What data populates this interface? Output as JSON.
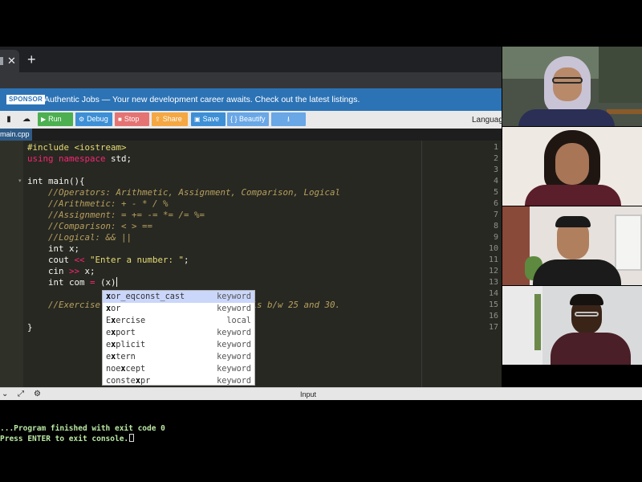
{
  "browser": {
    "tab_close": "✕",
    "new_tab": "+"
  },
  "banner": {
    "badge": "SPONSOR",
    "text": "Authentic Jobs — Your new development career awaits. Check out the latest listings."
  },
  "toolbar": {
    "run": "Run",
    "debug": "Debug",
    "stop": "Stop",
    "share": "Share",
    "save": "Save",
    "beautify": "{ } Beautify",
    "download": "⭳",
    "language": "Languag"
  },
  "file_tab": "main.cpp",
  "editor": {
    "line_numbers": [
      "1",
      "2",
      "3",
      "4",
      "5",
      "6",
      "7",
      "8",
      "9",
      "10",
      "11",
      "12",
      "13",
      "14",
      "15",
      "16",
      "17"
    ],
    "lines": {
      "l1_a": "#include",
      "l1_b": " <iostream>",
      "l2_a": "using",
      "l2_b": " namespace",
      "l2_c": " std;",
      "l4_a": "int",
      "l4_b": " main(){",
      "l5": "    //Operators: Arithmetic, Assignment, Comparison, Logical",
      "l6": "    //Arithmetic: + - * / %",
      "l7": "    //Assignment: = += -= *= /= %=",
      "l8": "    //Comparison: < > ==",
      "l9": "    //Logical: && ||",
      "l10_a": "    int",
      "l10_b": " x;",
      "l11_a": "    cout ",
      "l11_b": "<<",
      "l11_c": " \"Enter a number: \"",
      "l11_d": ";",
      "l12_a": "    cin ",
      "l12_b": ">>",
      "l12_c": " x;",
      "l13_a": "    int",
      "l13_b": " com ",
      "l13_c": "=",
      "l13_d": " (x)",
      "l15_a": "    //Exercise",
      "l15_b": "                      number is b/w 25 and 30.",
      "l17": "}"
    }
  },
  "autocomplete": [
    {
      "pre": "",
      "hl": "x",
      "post": "or_eqconst_cast",
      "type": "keyword"
    },
    {
      "pre": "",
      "hl": "x",
      "post": "or",
      "type": "keyword"
    },
    {
      "pre": "E",
      "hl": "x",
      "post": "ercise",
      "type": "local"
    },
    {
      "pre": "e",
      "hl": "x",
      "post": "port",
      "type": "keyword"
    },
    {
      "pre": "e",
      "hl": "x",
      "post": "plicit",
      "type": "keyword"
    },
    {
      "pre": "e",
      "hl": "x",
      "post": "tern",
      "type": "keyword"
    },
    {
      "pre": "noe",
      "hl": "x",
      "post": "cept",
      "type": "keyword"
    },
    {
      "pre": "conste",
      "hl": "x",
      "post": "pr",
      "type": "keyword"
    }
  ],
  "console": {
    "input_label": "Input",
    "line1": "...Program finished with exit code 0",
    "line2": "Press ENTER to exit console."
  },
  "colors": {
    "banner": "#2c73b6",
    "run": "#4caf50",
    "debug": "#3d8fd6",
    "stop": "#e57373",
    "share": "#f5a742",
    "save": "#3d8fd6",
    "beautify": "#69a7e6",
    "download": "#69a7e6"
  }
}
